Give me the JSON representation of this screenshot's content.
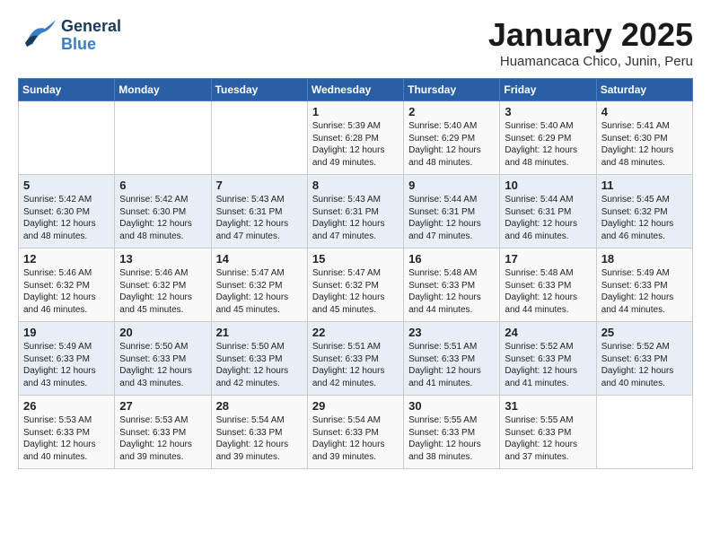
{
  "header": {
    "logo_general": "General",
    "logo_blue": "Blue",
    "month_title": "January 2025",
    "subtitle": "Huamancaca Chico, Junin, Peru"
  },
  "days_of_week": [
    "Sunday",
    "Monday",
    "Tuesday",
    "Wednesday",
    "Thursday",
    "Friday",
    "Saturday"
  ],
  "weeks": [
    [
      {
        "day": "",
        "sunrise": "",
        "sunset": "",
        "daylight": ""
      },
      {
        "day": "",
        "sunrise": "",
        "sunset": "",
        "daylight": ""
      },
      {
        "day": "",
        "sunrise": "",
        "sunset": "",
        "daylight": ""
      },
      {
        "day": "1",
        "sunrise": "Sunrise: 5:39 AM",
        "sunset": "Sunset: 6:28 PM",
        "daylight": "Daylight: 12 hours and 49 minutes."
      },
      {
        "day": "2",
        "sunrise": "Sunrise: 5:40 AM",
        "sunset": "Sunset: 6:29 PM",
        "daylight": "Daylight: 12 hours and 48 minutes."
      },
      {
        "day": "3",
        "sunrise": "Sunrise: 5:40 AM",
        "sunset": "Sunset: 6:29 PM",
        "daylight": "Daylight: 12 hours and 48 minutes."
      },
      {
        "day": "4",
        "sunrise": "Sunrise: 5:41 AM",
        "sunset": "Sunset: 6:30 PM",
        "daylight": "Daylight: 12 hours and 48 minutes."
      }
    ],
    [
      {
        "day": "5",
        "sunrise": "Sunrise: 5:42 AM",
        "sunset": "Sunset: 6:30 PM",
        "daylight": "Daylight: 12 hours and 48 minutes."
      },
      {
        "day": "6",
        "sunrise": "Sunrise: 5:42 AM",
        "sunset": "Sunset: 6:30 PM",
        "daylight": "Daylight: 12 hours and 48 minutes."
      },
      {
        "day": "7",
        "sunrise": "Sunrise: 5:43 AM",
        "sunset": "Sunset: 6:31 PM",
        "daylight": "Daylight: 12 hours and 47 minutes."
      },
      {
        "day": "8",
        "sunrise": "Sunrise: 5:43 AM",
        "sunset": "Sunset: 6:31 PM",
        "daylight": "Daylight: 12 hours and 47 minutes."
      },
      {
        "day": "9",
        "sunrise": "Sunrise: 5:44 AM",
        "sunset": "Sunset: 6:31 PM",
        "daylight": "Daylight: 12 hours and 47 minutes."
      },
      {
        "day": "10",
        "sunrise": "Sunrise: 5:44 AM",
        "sunset": "Sunset: 6:31 PM",
        "daylight": "Daylight: 12 hours and 46 minutes."
      },
      {
        "day": "11",
        "sunrise": "Sunrise: 5:45 AM",
        "sunset": "Sunset: 6:32 PM",
        "daylight": "Daylight: 12 hours and 46 minutes."
      }
    ],
    [
      {
        "day": "12",
        "sunrise": "Sunrise: 5:46 AM",
        "sunset": "Sunset: 6:32 PM",
        "daylight": "Daylight: 12 hours and 46 minutes."
      },
      {
        "day": "13",
        "sunrise": "Sunrise: 5:46 AM",
        "sunset": "Sunset: 6:32 PM",
        "daylight": "Daylight: 12 hours and 45 minutes."
      },
      {
        "day": "14",
        "sunrise": "Sunrise: 5:47 AM",
        "sunset": "Sunset: 6:32 PM",
        "daylight": "Daylight: 12 hours and 45 minutes."
      },
      {
        "day": "15",
        "sunrise": "Sunrise: 5:47 AM",
        "sunset": "Sunset: 6:32 PM",
        "daylight": "Daylight: 12 hours and 45 minutes."
      },
      {
        "day": "16",
        "sunrise": "Sunrise: 5:48 AM",
        "sunset": "Sunset: 6:33 PM",
        "daylight": "Daylight: 12 hours and 44 minutes."
      },
      {
        "day": "17",
        "sunrise": "Sunrise: 5:48 AM",
        "sunset": "Sunset: 6:33 PM",
        "daylight": "Daylight: 12 hours and 44 minutes."
      },
      {
        "day": "18",
        "sunrise": "Sunrise: 5:49 AM",
        "sunset": "Sunset: 6:33 PM",
        "daylight": "Daylight: 12 hours and 44 minutes."
      }
    ],
    [
      {
        "day": "19",
        "sunrise": "Sunrise: 5:49 AM",
        "sunset": "Sunset: 6:33 PM",
        "daylight": "Daylight: 12 hours and 43 minutes."
      },
      {
        "day": "20",
        "sunrise": "Sunrise: 5:50 AM",
        "sunset": "Sunset: 6:33 PM",
        "daylight": "Daylight: 12 hours and 43 minutes."
      },
      {
        "day": "21",
        "sunrise": "Sunrise: 5:50 AM",
        "sunset": "Sunset: 6:33 PM",
        "daylight": "Daylight: 12 hours and 42 minutes."
      },
      {
        "day": "22",
        "sunrise": "Sunrise: 5:51 AM",
        "sunset": "Sunset: 6:33 PM",
        "daylight": "Daylight: 12 hours and 42 minutes."
      },
      {
        "day": "23",
        "sunrise": "Sunrise: 5:51 AM",
        "sunset": "Sunset: 6:33 PM",
        "daylight": "Daylight: 12 hours and 41 minutes."
      },
      {
        "day": "24",
        "sunrise": "Sunrise: 5:52 AM",
        "sunset": "Sunset: 6:33 PM",
        "daylight": "Daylight: 12 hours and 41 minutes."
      },
      {
        "day": "25",
        "sunrise": "Sunrise: 5:52 AM",
        "sunset": "Sunset: 6:33 PM",
        "daylight": "Daylight: 12 hours and 40 minutes."
      }
    ],
    [
      {
        "day": "26",
        "sunrise": "Sunrise: 5:53 AM",
        "sunset": "Sunset: 6:33 PM",
        "daylight": "Daylight: 12 hours and 40 minutes."
      },
      {
        "day": "27",
        "sunrise": "Sunrise: 5:53 AM",
        "sunset": "Sunset: 6:33 PM",
        "daylight": "Daylight: 12 hours and 39 minutes."
      },
      {
        "day": "28",
        "sunrise": "Sunrise: 5:54 AM",
        "sunset": "Sunset: 6:33 PM",
        "daylight": "Daylight: 12 hours and 39 minutes."
      },
      {
        "day": "29",
        "sunrise": "Sunrise: 5:54 AM",
        "sunset": "Sunset: 6:33 PM",
        "daylight": "Daylight: 12 hours and 39 minutes."
      },
      {
        "day": "30",
        "sunrise": "Sunrise: 5:55 AM",
        "sunset": "Sunset: 6:33 PM",
        "daylight": "Daylight: 12 hours and 38 minutes."
      },
      {
        "day": "31",
        "sunrise": "Sunrise: 5:55 AM",
        "sunset": "Sunset: 6:33 PM",
        "daylight": "Daylight: 12 hours and 37 minutes."
      },
      {
        "day": "",
        "sunrise": "",
        "sunset": "",
        "daylight": ""
      }
    ]
  ]
}
